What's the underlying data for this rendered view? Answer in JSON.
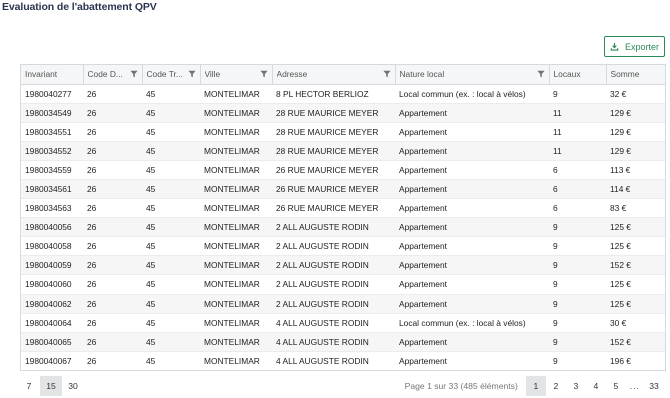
{
  "title": "Evaluation de l'abattement QPV",
  "export": {
    "label": "Exporter",
    "icon": "download-icon",
    "color": "#2e8b57"
  },
  "columns": [
    {
      "label": "Invariant",
      "filter": false
    },
    {
      "label": "Code D...",
      "filter": true
    },
    {
      "label": "Code Tr...",
      "filter": true
    },
    {
      "label": "Ville",
      "filter": true
    },
    {
      "label": "Adresse",
      "filter": true
    },
    {
      "label": "Nature local",
      "filter": true
    },
    {
      "label": "Locaux",
      "filter": false
    },
    {
      "label": "Somme",
      "filter": false
    }
  ],
  "rows": [
    [
      "1980040277",
      "26",
      "45",
      "MONTELIMAR",
      "8 PL HECTOR BERLIOZ",
      "Local commun (ex. : local à vélos)",
      "9",
      "32 €"
    ],
    [
      "1980034549",
      "26",
      "45",
      "MONTELIMAR",
      "28 RUE MAURICE MEYER",
      "Appartement",
      "11",
      "129 €"
    ],
    [
      "1980034551",
      "26",
      "45",
      "MONTELIMAR",
      "28 RUE MAURICE MEYER",
      "Appartement",
      "11",
      "129 €"
    ],
    [
      "1980034552",
      "26",
      "45",
      "MONTELIMAR",
      "28 RUE MAURICE MEYER",
      "Appartement",
      "11",
      "129 €"
    ],
    [
      "1980034559",
      "26",
      "45",
      "MONTELIMAR",
      "26 RUE MAURICE MEYER",
      "Appartement",
      "6",
      "113 €"
    ],
    [
      "1980034561",
      "26",
      "45",
      "MONTELIMAR",
      "26 RUE MAURICE MEYER",
      "Appartement",
      "6",
      "114 €"
    ],
    [
      "1980034563",
      "26",
      "45",
      "MONTELIMAR",
      "26 RUE MAURICE MEYER",
      "Appartement",
      "6",
      "83 €"
    ],
    [
      "1980040056",
      "26",
      "45",
      "MONTELIMAR",
      "2 ALL AUGUSTE RODIN",
      "Appartement",
      "9",
      "125 €"
    ],
    [
      "1980040058",
      "26",
      "45",
      "MONTELIMAR",
      "2 ALL AUGUSTE RODIN",
      "Appartement",
      "9",
      "125 €"
    ],
    [
      "1980040059",
      "26",
      "45",
      "MONTELIMAR",
      "2 ALL AUGUSTE RODIN",
      "Appartement",
      "9",
      "152 €"
    ],
    [
      "1980040060",
      "26",
      "45",
      "MONTELIMAR",
      "2 ALL AUGUSTE RODIN",
      "Appartement",
      "9",
      "125 €"
    ],
    [
      "1980040062",
      "26",
      "45",
      "MONTELIMAR",
      "2 ALL AUGUSTE RODIN",
      "Appartement",
      "9",
      "125 €"
    ],
    [
      "1980040064",
      "26",
      "45",
      "MONTELIMAR",
      "4 ALL AUGUSTE RODIN",
      "Local commun (ex. : local à vélos)",
      "9",
      "30 €"
    ],
    [
      "1980040065",
      "26",
      "45",
      "MONTELIMAR",
      "4 ALL AUGUSTE RODIN",
      "Appartement",
      "9",
      "152 €"
    ],
    [
      "1980040067",
      "26",
      "45",
      "MONTELIMAR",
      "4 ALL AUGUSTE RODIN",
      "Appartement",
      "9",
      "196 €"
    ]
  ],
  "page_sizes": {
    "options": [
      "7",
      "15",
      "30"
    ],
    "selected": "15"
  },
  "pagination": {
    "info": "Page 1 sur 33 (485 éléments)",
    "pages": [
      "1",
      "2",
      "3",
      "4",
      "5"
    ],
    "current": "1",
    "ellipsis": "...",
    "last": "33"
  }
}
